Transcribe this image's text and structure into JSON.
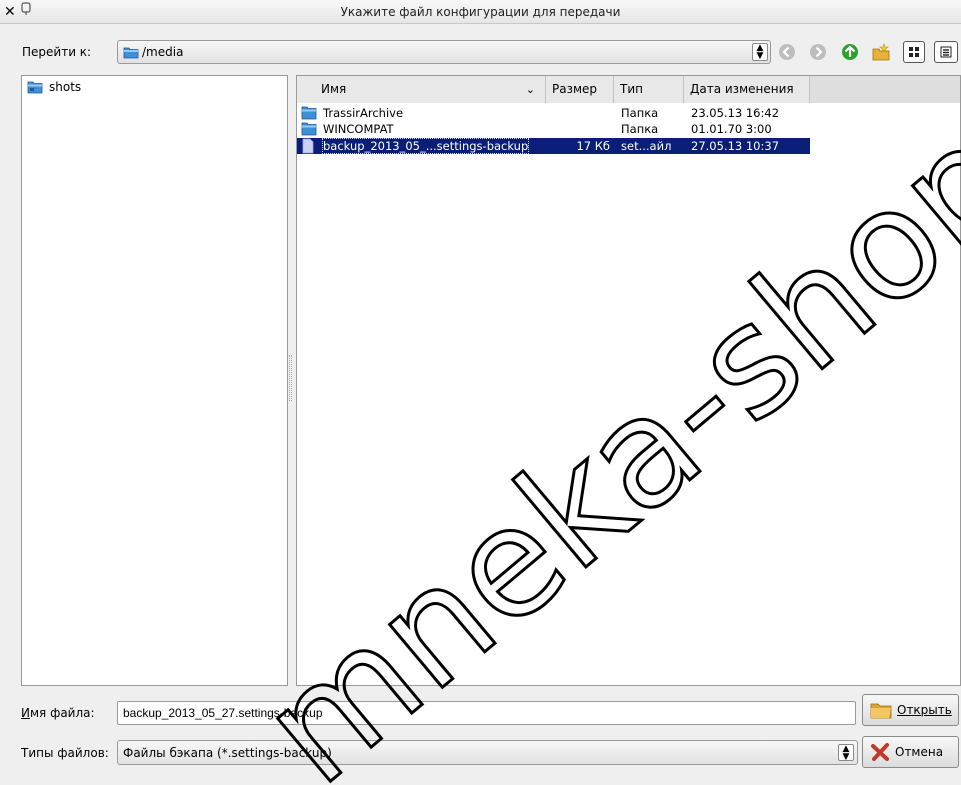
{
  "window": {
    "title": "Укажите файл конфигурации для передачи",
    "close_icon": "close-icon",
    "pin_icon": "pin-icon"
  },
  "toolbar": {
    "goto_label": "Перейти к:",
    "path": "/media",
    "buttons": [
      "back-icon",
      "forward-icon",
      "up-icon",
      "new-folder-icon",
      "icon-view-icon",
      "list-view-icon"
    ]
  },
  "sidebar": {
    "items": [
      {
        "label": "shots",
        "icon": "folder-icon"
      }
    ]
  },
  "file_list": {
    "columns": {
      "name": "Имя",
      "size": "Размер",
      "type": "Тип",
      "modified": "Дата изменения"
    },
    "rows": [
      {
        "name": "TrassirArchive",
        "size": "",
        "type": "Папка",
        "modified": "23.05.13 16:42",
        "icon": "folder-icon",
        "selected": false
      },
      {
        "name": "WINCOMPAT",
        "size": "",
        "type": "Папка",
        "modified": "01.01.70 3:00",
        "icon": "folder-icon",
        "selected": false
      },
      {
        "name": "backup_2013_05_...settings-backup",
        "size": "17 Кб",
        "type": "set...айл",
        "modified": "27.05.13 10:37",
        "icon": "file-icon",
        "selected": true
      }
    ]
  },
  "filename": {
    "label": "Имя файла:",
    "value": "backup_2013_05_27.settings-backup"
  },
  "filetype": {
    "label": "Типы файлов:",
    "value": "Файлы бэкапа (*.settings-backup)"
  },
  "actions": {
    "open_label": "Открыть",
    "cancel_label": "Отмена"
  },
  "watermark": {
    "text": "mneka-shop.com"
  },
  "colors": {
    "selection": "#0a1e78",
    "accent_green": "#2aa12a",
    "folder_blue": "#3d8fd6"
  }
}
